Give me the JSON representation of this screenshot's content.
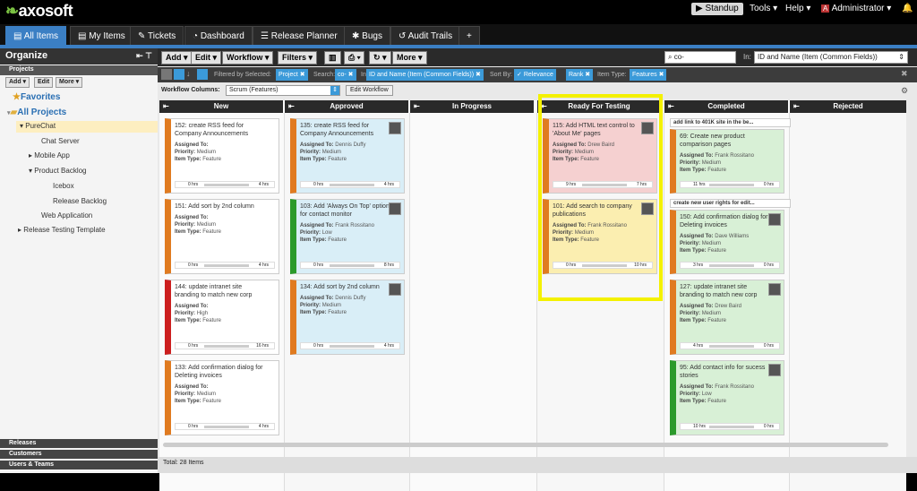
{
  "app": {
    "logo": "axosoft"
  },
  "topnav": {
    "standup": "Standup",
    "tools": "Tools",
    "help": "Help",
    "admin_initial": "A",
    "admin": "Administrator"
  },
  "tabs": [
    "All Items",
    "My Items",
    "Tickets",
    "Dashboard",
    "Release Planner",
    "Bugs",
    "Audit Trails",
    "+"
  ],
  "left": {
    "title": "Organize",
    "projects_header": "Projects",
    "buttons": [
      "Add",
      "Edit",
      "More"
    ],
    "favorites": "Favorites",
    "all_projects": "All Projects",
    "tree": [
      "PureChat",
      "Chat Server",
      "Mobile App",
      "Product Backlog",
      "Icebox",
      "Release Backlog",
      "Web Application",
      "Release Testing Template"
    ],
    "bottom": [
      "Releases",
      "Customers",
      "Users & Teams"
    ]
  },
  "toolbar": {
    "buttons": [
      "Add",
      "Edit",
      "Workflow",
      "Filters",
      "More"
    ],
    "search_value": "co-",
    "in_label": "In:",
    "in_value": "ID and Name (Item (Common Fields))"
  },
  "filterbar": {
    "filtered_by": "Filtered by Selected:",
    "project": "Project",
    "search_label": "Search:",
    "search": "co-",
    "in_label": "In:",
    "in_value": "ID and Name (Item (Common Fields))",
    "sort_label": "Sort By:",
    "sort1": "Relevance",
    "sort2": "Rank",
    "type_label": "Item Type:",
    "type": "Features"
  },
  "workflow": {
    "label": "Workflow Columns:",
    "value": "Scrum (Features)",
    "edit": "Edit Workflow"
  },
  "columns": [
    "New",
    "Approved",
    "In Progress",
    "Ready For Testing",
    "Completed",
    "Rejected"
  ],
  "cards": {
    "new": [
      {
        "title": "152: create RSS feed for Company Announcements",
        "assigned": "",
        "priority": "Medium",
        "type": "Feature",
        "left": "0 hrs",
        "right": "4 hrs",
        "color": "#e07b20"
      },
      {
        "title": "151: Add sort by 2nd column",
        "assigned": "",
        "priority": "Medium",
        "type": "Feature",
        "left": "0 hrs",
        "right": "4 hrs",
        "color": "#e07b20"
      },
      {
        "title": "144: update intranet site branding to match new corp",
        "assigned": "",
        "priority": "High",
        "type": "Feature",
        "left": "0 hrs",
        "right": "16 hrs",
        "color": "#cc1f1f"
      },
      {
        "title": "133: Add confirmation dialog for Deleting invoices",
        "assigned": "",
        "priority": "Medium",
        "type": "Feature",
        "left": "0 hrs",
        "right": "4 hrs",
        "color": "#e07b20"
      }
    ],
    "approved": [
      {
        "title": "135: create RSS feed for Company Announcements",
        "assigned": "Dennis Duffy",
        "priority": "Medium",
        "type": "Feature",
        "left": "0 hrs",
        "right": "4 hrs",
        "color": "#e07b20"
      },
      {
        "title": "103: Add 'Always On Top' option for contact monitor",
        "assigned": "Frank Rossitano",
        "priority": "Low",
        "type": "Feature",
        "left": "0 hrs",
        "right": "8 hrs",
        "color": "#2b9a2b"
      },
      {
        "title": "134: Add sort by 2nd column",
        "assigned": "Dennis Duffy",
        "priority": "Medium",
        "type": "Feature",
        "left": "0 hrs",
        "right": "4 hrs",
        "color": "#e07b20"
      }
    ],
    "ready": [
      {
        "title": "115: Add HTML text control to 'About Me' pages",
        "assigned": "Drew Baird",
        "priority": "Medium",
        "type": "Feature",
        "left": "9 hrs",
        "right": "7 hrs",
        "color": "#e07b20"
      },
      {
        "title": "101: Add search to company publications",
        "assigned": "Frank Rossitano",
        "priority": "Medium",
        "type": "Feature",
        "left": "0 hrs",
        "right": "10 hrs",
        "color": "#e07b20"
      }
    ],
    "completed": [
      {
        "link": "add link to 401K site in the be...",
        "title": "69: Create new product comparison pages",
        "assigned": "Frank Rossitano",
        "priority": "Medium",
        "type": "Feature",
        "left": "11 hrs",
        "right": "0 hrs",
        "color": "#e07b20"
      },
      {
        "link": "create new user rights for edit...",
        "title": "150: Add confirmation dialog for Deleting invoices",
        "assigned": "Dave Williams",
        "priority": "Medium",
        "type": "Feature",
        "left": "3 hrs",
        "right": "0 hrs",
        "color": "#e07b20"
      },
      {
        "link": "",
        "title": "127: update intranet site branding to match new corp",
        "assigned": "Drew Baird",
        "priority": "Medium",
        "type": "Feature",
        "left": "4 hrs",
        "right": "0 hrs",
        "color": "#e07b20"
      },
      {
        "link": "",
        "title": "95: Add contact info for sucess stories",
        "assigned": "Frank Rossitano",
        "priority": "Low",
        "type": "Feature",
        "left": "10 hrs",
        "right": "0 hrs",
        "color": "#2b9a2b"
      }
    ]
  },
  "labels": {
    "assigned": "Assigned To:",
    "priority": "Priority:",
    "type": "Item Type:"
  },
  "status": {
    "total": "Total: 28 Items"
  }
}
